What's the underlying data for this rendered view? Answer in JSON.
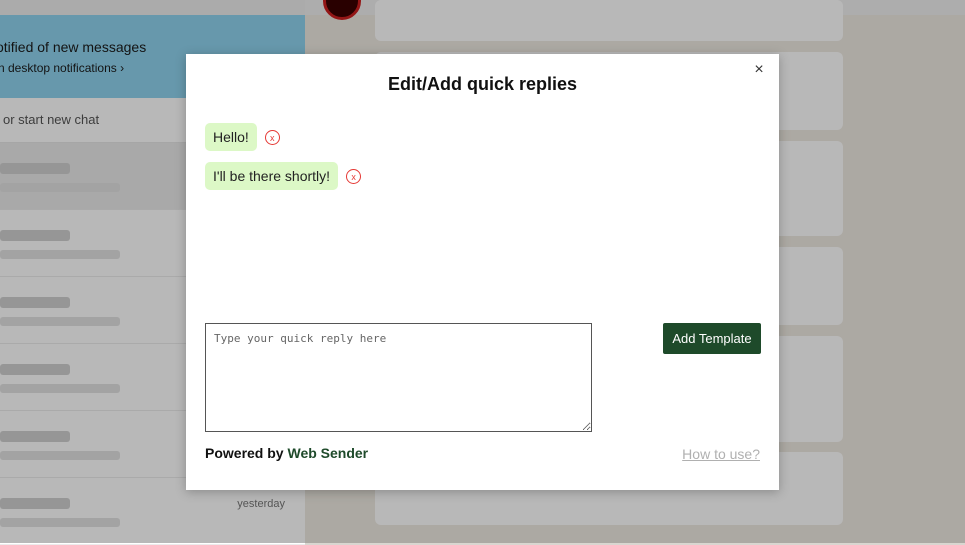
{
  "background": {
    "notification": {
      "title": "otified of new messages",
      "link": "n desktop notifications ›"
    },
    "search": {
      "placeholder": "or start new chat"
    },
    "chats": [
      {
        "time": ""
      },
      {
        "time": ""
      },
      {
        "time": ""
      },
      {
        "time": ""
      },
      {
        "time": ""
      },
      {
        "time": "yesterday"
      }
    ]
  },
  "modal": {
    "title": "Edit/Add quick replies",
    "close_label": "×",
    "delete_label": "x",
    "replies": [
      {
        "text": "Hello!"
      },
      {
        "text": "I'll be there shortly!"
      }
    ],
    "input": {
      "placeholder": "Type your quick reply here",
      "value": ""
    },
    "add_button": "Add Template",
    "powered_prefix": "Powered by",
    "powered_brand": "Web Sender",
    "how_to": "How to use?"
  },
  "colors": {
    "accent": "#1e4a2a",
    "chip": "#dcf8c6",
    "delete": "#e53935",
    "notify_bar": "#8fd3ef"
  }
}
